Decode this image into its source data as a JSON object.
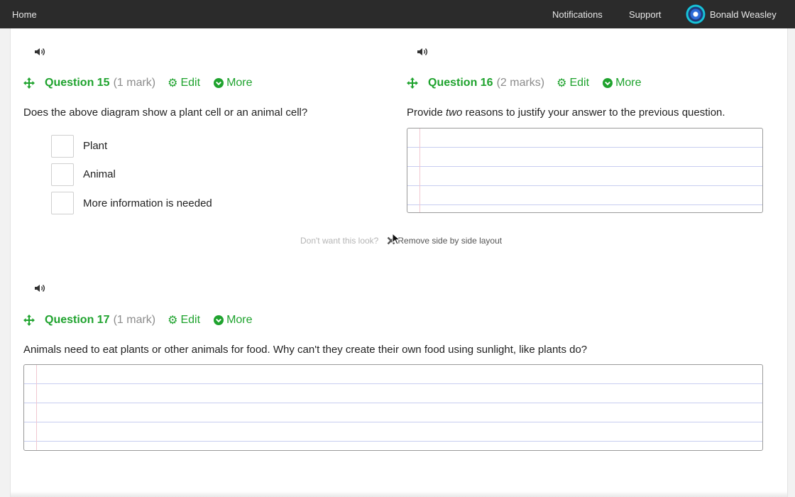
{
  "topbar": {
    "home": "Home",
    "notifications": "Notifications",
    "support": "Support",
    "user_name": "Bonald Weasley"
  },
  "questions": [
    {
      "title": "Question 15",
      "marks": "(1 mark)",
      "edit": "Edit",
      "more": "More",
      "text": "Does the above diagram show a plant cell or an animal cell?",
      "options": [
        "Plant",
        "Animal",
        "More information is needed"
      ]
    },
    {
      "title": "Question 16",
      "marks": "(2 marks)",
      "edit": "Edit",
      "more": "More",
      "text_before": "Provide ",
      "text_emph": "two",
      "text_after": " reasons to justify your answer to the previous question."
    },
    {
      "title": "Question 17",
      "marks": "(1 mark)",
      "edit": "Edit",
      "more": "More",
      "text": "Animals need to eat plants or other animals for food. Why can't they create their own food using sunlight, like plants do?"
    }
  ],
  "layout_notice": {
    "prompt": "Don't want this look?",
    "remove": "Remove side by side layout"
  },
  "colors": {
    "accent": "#1fa32e",
    "topbar": "#2b2b2b"
  },
  "icons": [
    "speaker-icon",
    "move-icon",
    "gear-icon",
    "chevron-down-circle-icon",
    "close-icon",
    "cursor-icon"
  ]
}
